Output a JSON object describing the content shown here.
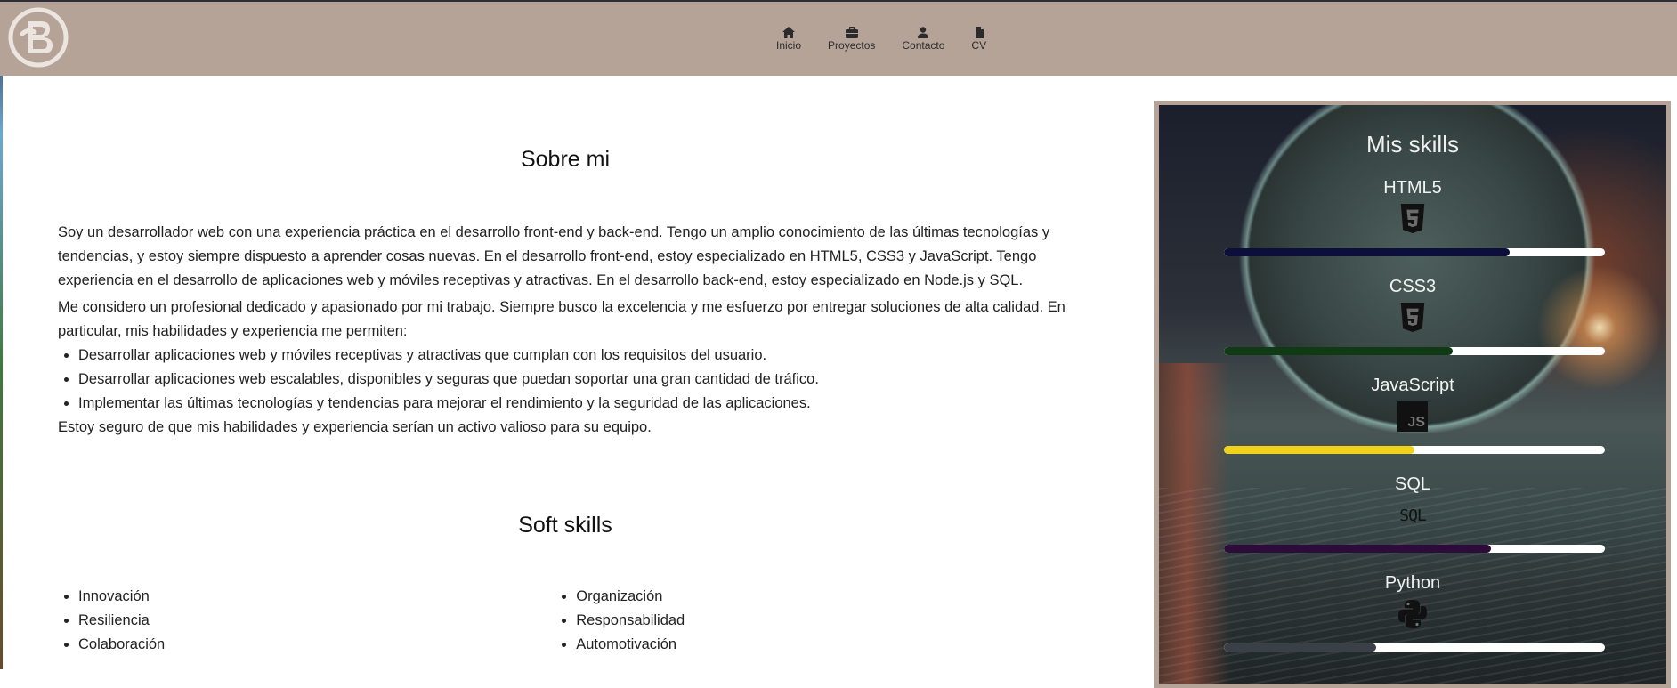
{
  "nav": {
    "items": [
      {
        "label": "Inicio",
        "icon": "home-icon"
      },
      {
        "label": "Proyectos",
        "icon": "briefcase-icon"
      },
      {
        "label": "Contacto",
        "icon": "user-icon"
      },
      {
        "label": "CV",
        "icon": "file-icon"
      }
    ]
  },
  "about": {
    "title": "Sobre mi",
    "paragraph1": "Soy un desarrollador web con una experiencia práctica en el desarrollo front-end y back-end. Tengo un amplio conocimiento de las últimas tecnologías y tendencias, y estoy siempre dispuesto a aprender cosas nuevas. En el desarrollo front-end, estoy especializado en HTML5, CSS3 y JavaScript. Tengo experiencia en el desarrollo de aplicaciones web y móviles receptivas y atractivas. En el desarrollo back-end, estoy especializado en Node.js y SQL.",
    "paragraph2": "Me considero un profesional dedicado y apasionado por mi trabajo. Siempre busco la excelencia y me esfuerzo por entregar soluciones de alta calidad. En particular, mis habilidades y experiencia me permiten:",
    "bullets": [
      "Desarrollar aplicaciones web y móviles receptivas y atractivas que cumplan con los requisitos del usuario.",
      "Desarrollar aplicaciones web escalables, disponibles y seguras que puedan soportar una gran cantidad de tráfico.",
      "Implementar las últimas tecnologías y tendencias para mejorar el rendimiento y la seguridad de las aplicaciones."
    ],
    "closing": "Estoy seguro de que mis habilidades y experiencia serían un activo valioso para su equipo."
  },
  "soft_skills": {
    "title": "Soft skills",
    "left": [
      "Innovación",
      "Resiliencia",
      "Colaboración"
    ],
    "right": [
      "Organización",
      "Responsabilidad",
      "Automotivación"
    ]
  },
  "skills": {
    "title": "Mis skills",
    "items": [
      {
        "name": "HTML5",
        "icon": "html5-icon",
        "level": 0.75,
        "color": "#0b0f3a"
      },
      {
        "name": "CSS3",
        "icon": "css3-icon",
        "level": 0.6,
        "color": "#103a14"
      },
      {
        "name": "JavaScript",
        "icon": "javascript-icon",
        "level": 0.5,
        "color": "#f0d21a"
      },
      {
        "name": "SQL",
        "icon": "sql-icon",
        "level": 0.7,
        "color": "#2e0c3a"
      },
      {
        "name": "Python",
        "icon": "python-icon",
        "level": 0.4,
        "color": "#3a3f48"
      }
    ],
    "javascript_icon_text": "JS",
    "sql_icon_text": "SQL"
  },
  "colors": {
    "nav_background": "#b5a398",
    "panel_border": "#b5a398"
  }
}
